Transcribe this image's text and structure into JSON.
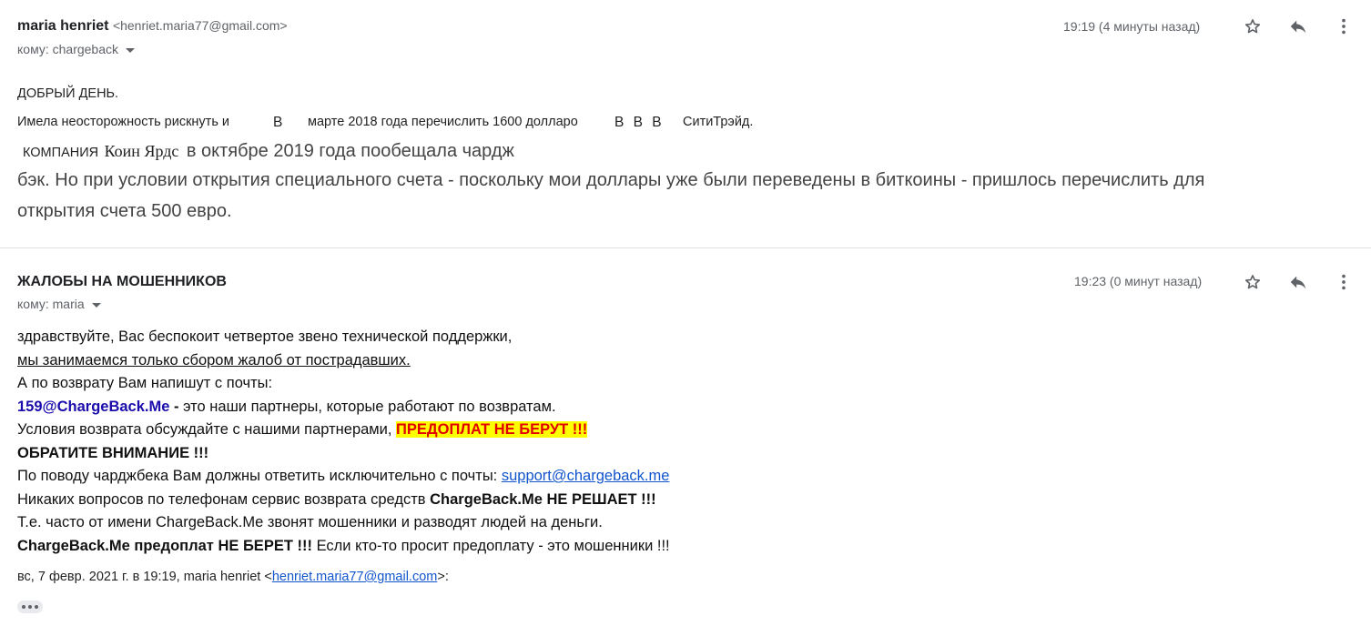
{
  "message1": {
    "sender_name": "maria henriet",
    "sender_email": "<henriet.maria77@gmail.com>",
    "to_label": "кому: chargeback",
    "time": "19:19 (4 минуты назад)",
    "greeting": "ДОБРЫЙ ДЕНЬ.",
    "line1_a": "Имела неосторожность рискнуть и",
    "line1_b": "В",
    "line1_c": "марте 2018 года перечислить 1600 долларо",
    "line1_d": "В В В",
    "line1_e": "СитиТрэйд.",
    "line2_a": "КОМПАНИЯ",
    "line2_b": "Коин Ярдс",
    "line2_c": "в октябре 2019 года пообещала чардж",
    "line3": "бэк. Но при условии открытия специального счета - поскольку мои доллары уже были переведены в биткоины - пришлось перечислить для",
    "line4": "открытия счета 500 евро."
  },
  "message2": {
    "sender_name": "ЖАЛОБЫ НА МОШЕННИКОВ",
    "to_label": "кому: maria",
    "time": "19:23 (0 минут назад)",
    "l1": "здравствуйте, Вас беспокоит четвертое звено технической поддержки,",
    "l2": "мы занимаемся только сбором жалоб от пострадавших.",
    "l3": "А по возврату Вам напишут с почты:",
    "l4_email": "159@ChargeBack.Me",
    "l4_dash": " - ",
    "l4_rest": "это наши партнеры, которые работают по возвратам.",
    "l5_text": "Условия возврата обсуждайте с нашими партнерами, ",
    "l5_hl": "ПРЕДОПЛАТ НЕ БЕРУТ !!!",
    "l6": "ОБРАТИТЕ ВНИМАНИЕ !!!",
    "l7_text": "По поводу чарджбека Вам должны ответить исключительно с почты: ",
    "l7_link": "support@chargeback.me",
    "l8_text": "Никаких вопросов по телефонам сервис возврата средств ",
    "l8_bold": "ChargeBack.Me НЕ РЕШАЕТ !!!",
    "l9": "Т.е. часто от имени ChargeBack.Me звонят мошенники и разводят людей на деньги.",
    "l10_bold": "ChargeBack.Me предоплат НЕ БЕРЕТ !!!",
    "l10_text": " Если кто-то просит предоплату - это мошенники !!!",
    "quote_prefix": "вс, 7 февр. 2021 г. в 19:19, maria henriet <",
    "quote_email": "henriet.maria77@gmail.com",
    "quote_suffix": ">:"
  },
  "icons": {
    "star": "star-icon",
    "reply": "reply-icon",
    "more": "more-vert-icon",
    "ellipsis": "show-trimmed-content-icon"
  },
  "colors": {
    "link": "#1155cc",
    "blue_email": "#1a0dab",
    "highlight_bg": "#ffff00",
    "highlight_text": "#e00000"
  }
}
